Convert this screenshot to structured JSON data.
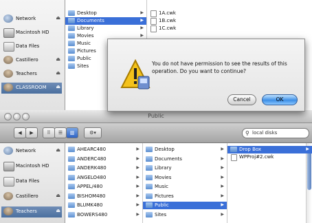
{
  "back_window": {
    "sidebar": [
      {
        "label": "Network",
        "icon": "network-icon",
        "eject": true
      },
      {
        "label": "Macintosh HD",
        "icon": "hard-disk-icon",
        "eject": false
      },
      {
        "label": "Data Files",
        "icon": "drive-icon",
        "eject": false
      },
      {
        "label": "Castillero",
        "icon": "user-icon",
        "eject": true
      },
      {
        "label": "Teachers",
        "icon": "user-icon",
        "eject": true
      },
      {
        "label": "CLASSROOM",
        "icon": "user-icon",
        "eject": true,
        "selected": true
      }
    ],
    "col1": [
      {
        "label": "Desktop"
      },
      {
        "label": "Documents",
        "selected": true
      },
      {
        "label": "Library"
      },
      {
        "label": "Movies"
      },
      {
        "label": "Music"
      },
      {
        "label": "Pictures"
      },
      {
        "label": "Public"
      },
      {
        "label": "Sites"
      }
    ],
    "col2": [
      {
        "label": "1A.cwk"
      },
      {
        "label": "1B.cwk"
      },
      {
        "label": "1C.cwk"
      }
    ]
  },
  "alert": {
    "message": "You do not have permission to see the results of this operation. Do you want to continue?",
    "cancel_label": "Cancel",
    "ok_label": "OK",
    "icon": "caution-icon"
  },
  "front_window": {
    "title": "Public",
    "toolbar": {
      "back": "◀",
      "forward": "▶",
      "view_icon": "⠿",
      "view_list": "☰",
      "view_column": "▥",
      "action": "⚙▾"
    },
    "search": {
      "value": "local disks",
      "icon": "search-icon"
    },
    "sidebar": [
      {
        "label": "Network",
        "icon": "network-icon",
        "eject": true
      },
      {
        "label": "Macintosh HD",
        "icon": "hard-disk-icon",
        "eject": false
      },
      {
        "label": "Data Files",
        "icon": "drive-icon",
        "eject": false
      },
      {
        "label": "Castillero",
        "icon": "user-icon",
        "eject": true
      },
      {
        "label": "Teachers",
        "icon": "user-icon",
        "eject": true,
        "selected": true
      }
    ],
    "col1": [
      {
        "label": "AHEARC480"
      },
      {
        "label": "ANDERC480"
      },
      {
        "label": "ANDERK480"
      },
      {
        "label": "ANGELO480"
      },
      {
        "label": "APPEL/480"
      },
      {
        "label": "BISHOM480"
      },
      {
        "label": "BLUMK480"
      },
      {
        "label": "BOWERS480"
      }
    ],
    "col2": [
      {
        "label": "Desktop"
      },
      {
        "label": "Documents"
      },
      {
        "label": "Library"
      },
      {
        "label": "Movies"
      },
      {
        "label": "Music"
      },
      {
        "label": "Pictures"
      },
      {
        "label": "Public",
        "selected": true
      },
      {
        "label": "Sites"
      }
    ],
    "col3": [
      {
        "label": "Drop Box",
        "selected": true,
        "folder": true
      },
      {
        "label": "WPProj#2.cwk",
        "folder": false
      }
    ]
  },
  "colors": {
    "selection": "#3a6fd8",
    "sidebar_selection": "#4a6f9f",
    "ok_button": "#3e8fe6"
  }
}
